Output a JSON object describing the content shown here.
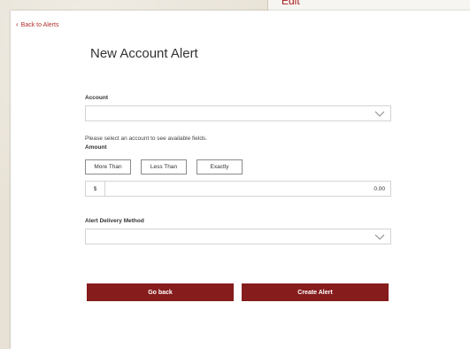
{
  "background": {
    "edit_label": "Edit"
  },
  "nav": {
    "back_label": "Back to Alerts"
  },
  "page": {
    "title": "New Account Alert"
  },
  "form": {
    "account": {
      "label": "Account",
      "value": "",
      "hint": "Please select an account to see available fields."
    },
    "amount": {
      "label": "Amount",
      "options": [
        "More Than",
        "Less Than",
        "Exactly"
      ],
      "currency_symbol": "$",
      "value": "0.00"
    },
    "delivery": {
      "label": "Alert Delivery Method",
      "value": ""
    }
  },
  "actions": {
    "go_back_label": "Go back",
    "create_label": "Create Alert"
  },
  "colors": {
    "accent": "#861c1c",
    "link": "#b0302a"
  }
}
